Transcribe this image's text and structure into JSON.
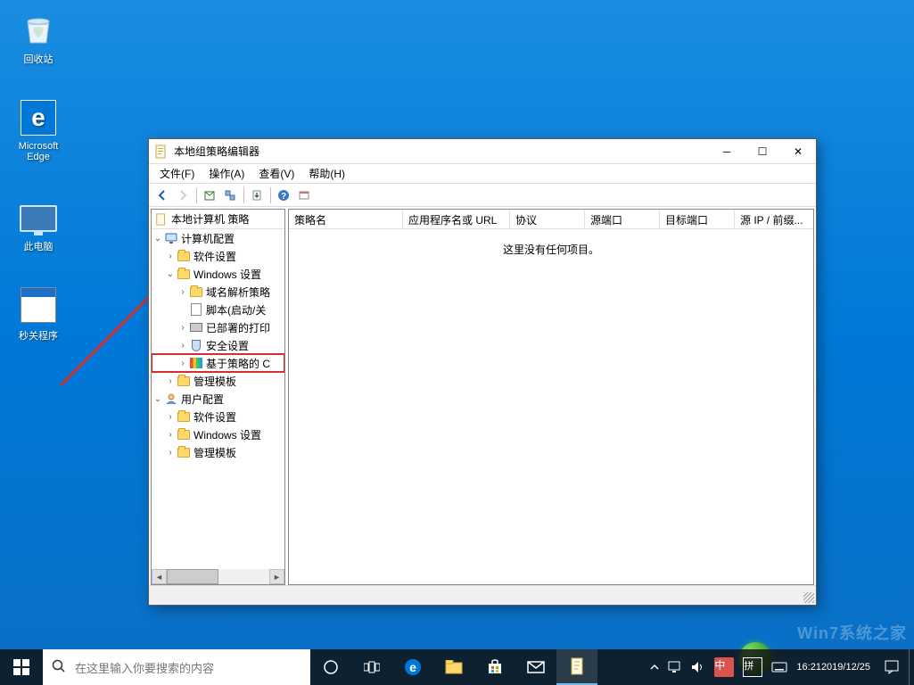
{
  "desktop": {
    "icons": [
      {
        "name": "recycle-bin",
        "label": "回收站"
      },
      {
        "name": "edge",
        "label": "Microsoft Edge"
      },
      {
        "name": "this-pc",
        "label": "此电脑"
      },
      {
        "name": "shutdown-prog",
        "label": "秒关程序"
      }
    ]
  },
  "window": {
    "title": "本地组策略编辑器",
    "menu": {
      "file": "文件(F)",
      "action": "操作(A)",
      "view": "查看(V)",
      "help": "帮助(H)"
    },
    "tree_root": "本地计算机 策略",
    "tree": {
      "computer_config": "计算机配置",
      "software_settings": "软件设置",
      "windows_settings": "Windows 设置",
      "name_resolution": "域名解析策略",
      "scripts": "脚本(启动/关",
      "deployed_printers": "已部署的打印",
      "security_settings": "安全设置",
      "policy_based_qos": "基于策略的 C",
      "admin_templates": "管理模板",
      "user_config": "用户配置",
      "software_settings2": "软件设置",
      "windows_settings2": "Windows 设置",
      "admin_templates2": "管理模板"
    },
    "columns": {
      "c1": "策略名",
      "c2": "应用程序名或 URL",
      "c3": "协议",
      "c4": "源端口",
      "c5": "目标端口",
      "c6": "源 IP / 前缀..."
    },
    "empty": "这里没有任何项目。"
  },
  "taskbar": {
    "search_placeholder": "在这里输入你要搜索的内容",
    "time": "16:21",
    "date": "2019/12/25",
    "ime1": "中",
    "ime2": "拼"
  },
  "watermark": "Win7系统之家"
}
